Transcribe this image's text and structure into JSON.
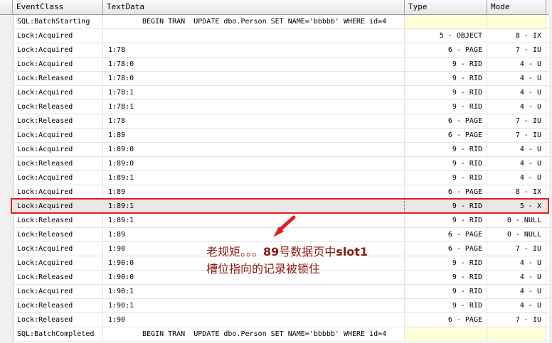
{
  "columns": [
    "EventClass",
    "TextData",
    "Type",
    "Mode"
  ],
  "rows": [
    {
      "event": "SQL:BatchStarting",
      "text": "BEGIN TRAN  UPDATE dbo.Person SET NAME='bbbbb' WHERE id=4",
      "type": "",
      "mode": "",
      "batch": true
    },
    {
      "event": "Lock:Acquired",
      "text": "",
      "type": "5 - OBJECT",
      "mode": "8 - IX"
    },
    {
      "event": "Lock:Acquired",
      "text": "1:78",
      "type": "6 - PAGE",
      "mode": "7 - IU"
    },
    {
      "event": "Lock:Acquired",
      "text": "1:78:0",
      "type": "9 - RID",
      "mode": "4 - U"
    },
    {
      "event": "Lock:Released",
      "text": "1:78:0",
      "type": "9 - RID",
      "mode": "4 - U"
    },
    {
      "event": "Lock:Acquired",
      "text": "1:78:1",
      "type": "9 - RID",
      "mode": "4 - U"
    },
    {
      "event": "Lock:Released",
      "text": "1:78:1",
      "type": "9 - RID",
      "mode": "4 - U"
    },
    {
      "event": "Lock:Released",
      "text": "1:78",
      "type": "6 - PAGE",
      "mode": "7 - IU"
    },
    {
      "event": "Lock:Acquired",
      "text": "1:89",
      "type": "6 - PAGE",
      "mode": "7 - IU"
    },
    {
      "event": "Lock:Acquired",
      "text": "1:89:0",
      "type": "9 - RID",
      "mode": "4 - U"
    },
    {
      "event": "Lock:Released",
      "text": "1:89:0",
      "type": "9 - RID",
      "mode": "4 - U"
    },
    {
      "event": "Lock:Acquired",
      "text": "1:89:1",
      "type": "9 - RID",
      "mode": "4 - U"
    },
    {
      "event": "Lock:Acquired",
      "text": "1:89",
      "type": "6 - PAGE",
      "mode": "8 - IX"
    },
    {
      "event": "Lock:Acquired",
      "text": "1:89:1",
      "type": "9 - RID",
      "mode": "5 - X",
      "selected": true
    },
    {
      "event": "Lock:Released",
      "text": "1:89:1",
      "type": "9 - RID",
      "mode": "0 - NULL"
    },
    {
      "event": "Lock:Released",
      "text": "1:89",
      "type": "6 - PAGE",
      "mode": "0 - NULL"
    },
    {
      "event": "Lock:Acquired",
      "text": "1:90",
      "type": "6 - PAGE",
      "mode": "7 - IU"
    },
    {
      "event": "Lock:Acquired",
      "text": "1:90:0",
      "type": "9 - RID",
      "mode": "4 - U"
    },
    {
      "event": "Lock:Released",
      "text": "1:90:0",
      "type": "9 - RID",
      "mode": "4 - U"
    },
    {
      "event": "Lock:Acquired",
      "text": "1:90:1",
      "type": "9 - RID",
      "mode": "4 - U"
    },
    {
      "event": "Lock:Released",
      "text": "1:90:1",
      "type": "9 - RID",
      "mode": "4 - U"
    },
    {
      "event": "Lock:Released",
      "text": "1:90",
      "type": "6 - PAGE",
      "mode": "7 - IU"
    },
    {
      "event": "SQL:BatchCompleted",
      "text": "BEGIN TRAN  UPDATE dbo.Person SET NAME='bbbbb' WHERE id=4",
      "type": "",
      "mode": "",
      "batch": true
    }
  ],
  "annotation": {
    "line1_prefix": "老规矩。。。",
    "line1_bold": "89",
    "line1_mid": "号数据页中",
    "line1_bold2": "slot1",
    "line2": "槽位指向的记录被锁住",
    "color": "#8a1d10",
    "arrow_color": "#e02020"
  }
}
